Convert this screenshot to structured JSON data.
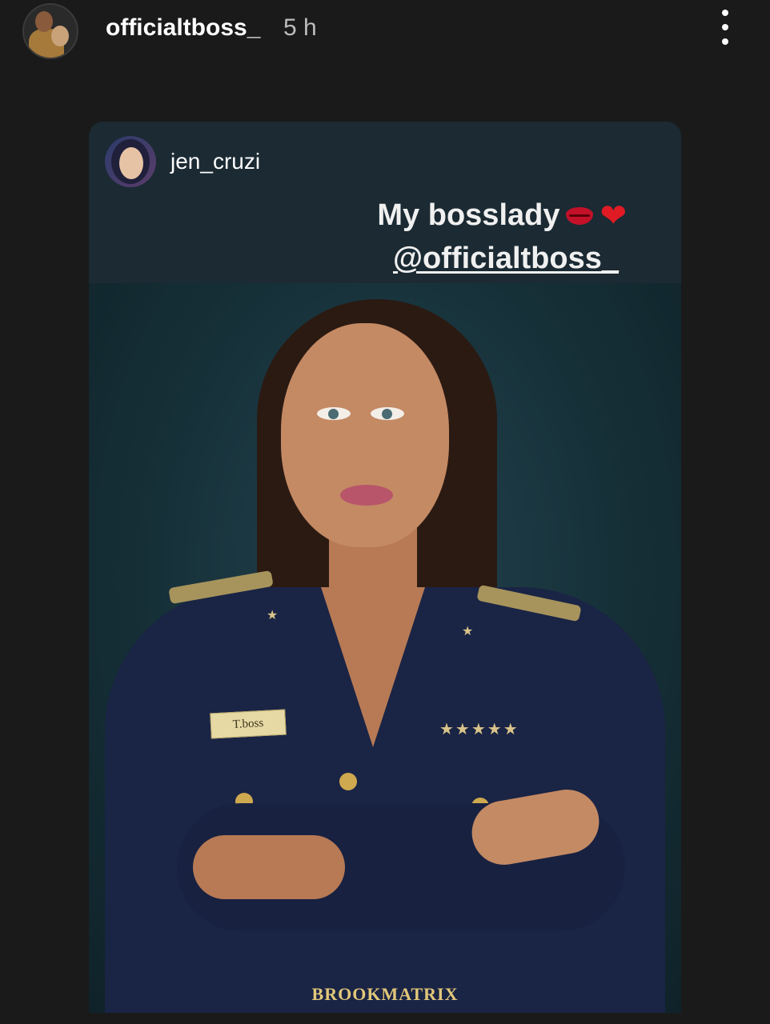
{
  "header": {
    "username": "officialtboss_",
    "time": "5 h",
    "more_icon": "more-vertical-icon"
  },
  "shared_post": {
    "author": "jen_cruzi",
    "caption_line1": "My bosslady",
    "caption_emojis": [
      "kiss-mark-emoji",
      "red-heart-emoji"
    ],
    "caption_heart": "❤",
    "caption_mention": "@officialtboss_",
    "photo": {
      "name_plate": "T.boss",
      "stars": "★★★★★",
      "star_single": "★",
      "watermark": "BROOKMATRIX"
    }
  },
  "colors": {
    "background": "#1a1a1a",
    "card": "#1b2a33",
    "text": "#ffffff",
    "heart": "#e01b24"
  }
}
